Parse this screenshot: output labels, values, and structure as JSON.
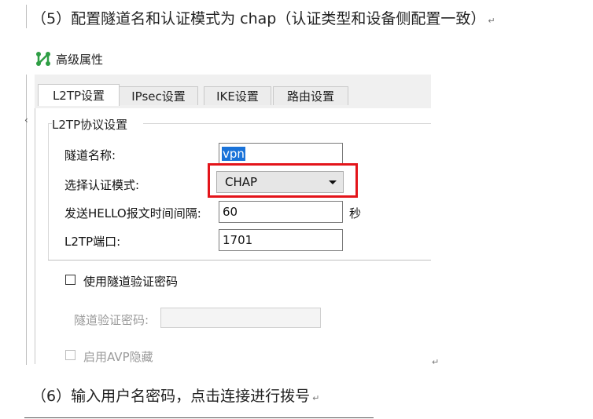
{
  "doc": {
    "step5": "（5）配置隧道名和认证模式为 chap（认证类型和设备侧配置一致）",
    "step6": "（6）输入用户名密码，点击连接进行拨号",
    "para_mark": "↵"
  },
  "dialog": {
    "title": "高级属性",
    "tabs": [
      "L2TP设置",
      "IPsec设置",
      "IKE设置",
      "路由设置"
    ],
    "active_tab": "L2TP设置",
    "group_title": "L2TP协议设置",
    "fields": {
      "tunnel_name_label": "隧道名称:",
      "tunnel_name_value": "vpn",
      "auth_mode_label": "选择认证模式:",
      "auth_mode_value": "CHAP",
      "hello_label": "发送HELLO报文时间间隔:",
      "hello_value": "60",
      "hello_unit": "秒",
      "port_label": "L2TP端口:",
      "port_value": "1701"
    },
    "use_tunnel_password_label": "使用隧道验证密码",
    "tunnel_password_label": "隧道验证密码:",
    "tunnel_password_value": "",
    "enable_avp_hiding_label": "启用AVP隐藏"
  },
  "colors": {
    "highlight_box": "#e3141a",
    "selection": "#1a73d9",
    "icon": "#2e9e44"
  }
}
